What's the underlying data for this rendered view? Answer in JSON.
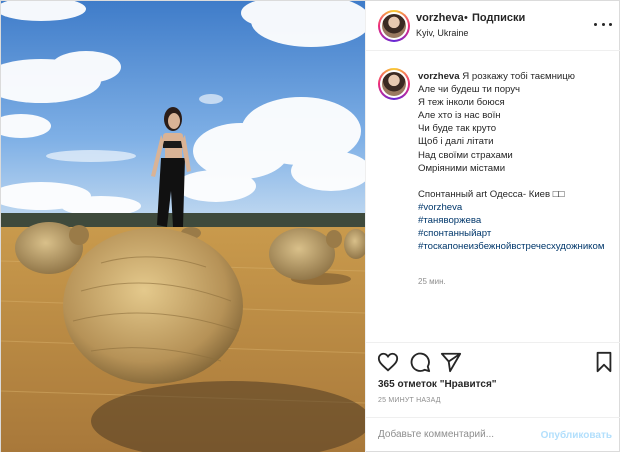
{
  "post": {
    "username": "vorzheva",
    "separator": "•",
    "follow_label": "Подписки",
    "location": "Kyiv, Ukraine",
    "more_icon": "more-horizontal-icon"
  },
  "caption": {
    "username": "vorzheva",
    "first_line": " Я розкажу тобі таємницю",
    "lines": [
      "Але чи будеш ти поруч",
      "Я теж інколи боюся",
      "Але хто із нас воїн",
      "Чи буде так круто",
      "Щоб і далі літати",
      "Над своїми страхами",
      "Омріяними містами"
    ],
    "after_gap": "Спонтанный art Одесса- Киев □□",
    "hashtags": [
      "#vorzheva",
      "#таняворжева",
      "#спонтанныйарт",
      "#тоскапонеизбежнойвстречесхудожником"
    ],
    "time": "25 мин."
  },
  "actions": {
    "icons": [
      "heart-icon",
      "comment-icon",
      "share-icon",
      "bookmark-icon"
    ],
    "likes": "365 отметок \"Нравится\"",
    "posted_ago": "25 МИНУТ НАЗАД"
  },
  "comment_box": {
    "placeholder": "Добавьте комментарий...",
    "publish_label": "Опубликовать"
  },
  "colors": {
    "link": "#00376b",
    "publish_disabled": "#b2dffc",
    "muted": "#8e8e8e",
    "text": "#262626"
  }
}
